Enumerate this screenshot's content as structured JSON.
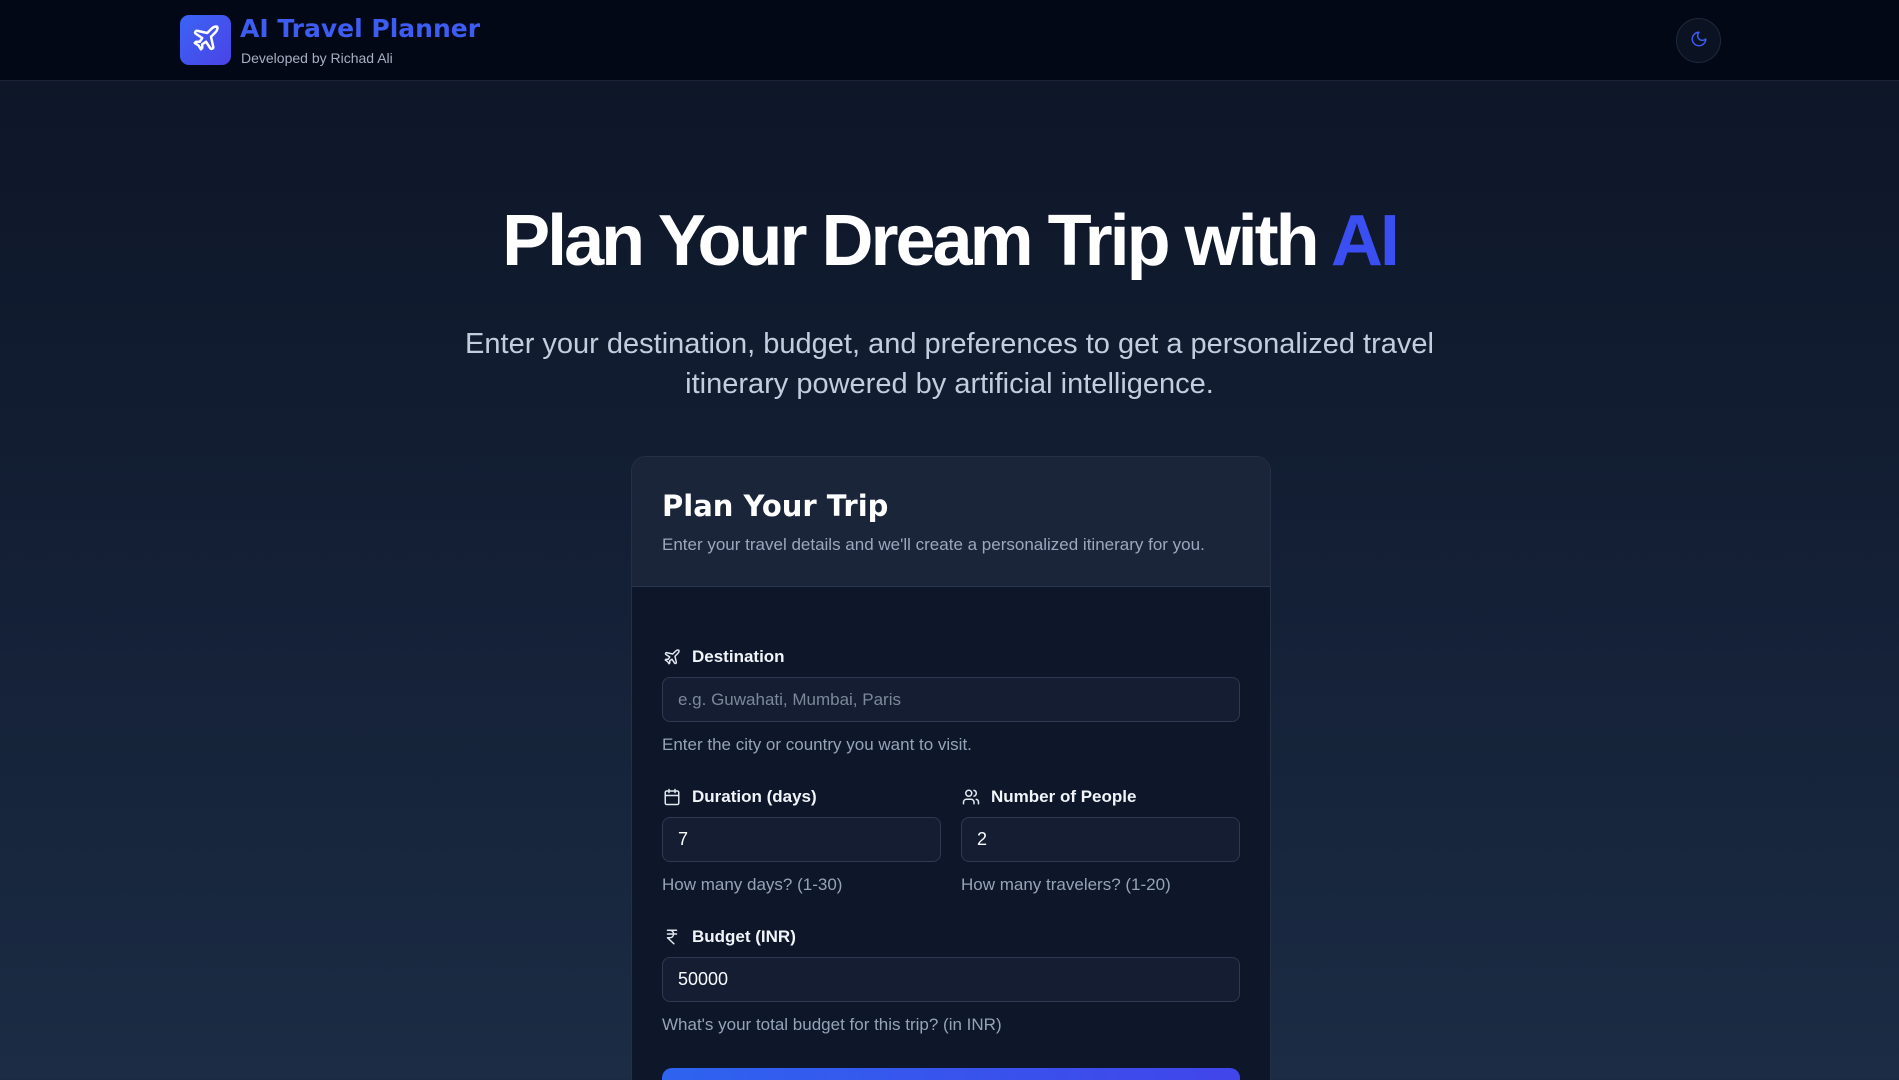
{
  "header": {
    "brand_title": "AI Travel Planner",
    "brand_subtitle": "Developed by Richad Ali",
    "logo_icon": "plane-icon",
    "theme_toggle_icon": "moon-icon"
  },
  "hero": {
    "title_main": "Plan Your Dream Trip with ",
    "title_accent": "AI",
    "subtitle": "Enter your destination, budget, and preferences to get a personalized travel itinerary powered by artificial intelligence."
  },
  "form": {
    "title": "Plan Your Trip",
    "description": "Enter your travel details and we'll create a personalized itinerary for you.",
    "destination": {
      "label": "Destination",
      "placeholder": "e.g. Guwahati, Mumbai, Paris",
      "value": "",
      "hint": "Enter the city or country you want to visit."
    },
    "duration": {
      "label": "Duration (days)",
      "value": "7",
      "hint": "How many days? (1-30)"
    },
    "people": {
      "label": "Number of People",
      "value": "2",
      "hint": "How many travelers? (1-20)"
    },
    "budget": {
      "label": "Budget (INR)",
      "value": "50000",
      "hint": "What's your total budget for this trip? (in INR)"
    }
  },
  "colors": {
    "accent": "#3b4ef2",
    "header_bg": "#030816",
    "card_bg": "#0e1629"
  }
}
